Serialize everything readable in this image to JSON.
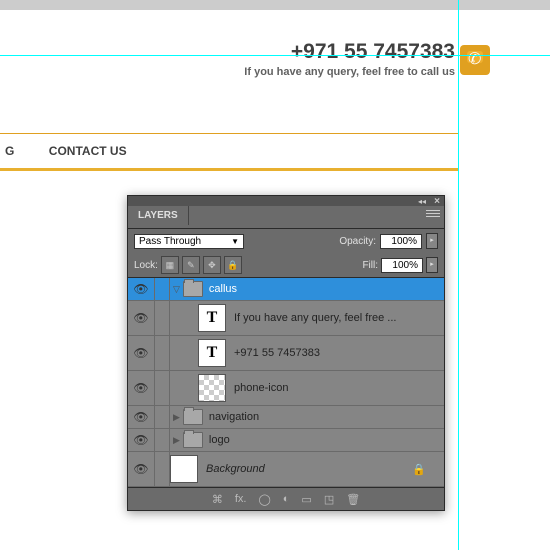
{
  "header": {
    "phone": "+971 55 7457383",
    "query": "If you have any query, feel free to call us"
  },
  "nav": {
    "item1": "G",
    "item2": "CONTACT US"
  },
  "panel": {
    "tab": "LAYERS",
    "blend": "Pass Through",
    "opacity_label": "Opacity:",
    "opacity_value": "100%",
    "lock_label": "Lock:",
    "fill_label": "Fill:",
    "fill_value": "100%"
  },
  "layers": {
    "l0": "callus",
    "l1": "If you have any query, feel free ...",
    "l2": "+971 55 7457383",
    "l3": "phone-icon",
    "l4": "navigation",
    "l5": "logo",
    "l6": "Background"
  }
}
